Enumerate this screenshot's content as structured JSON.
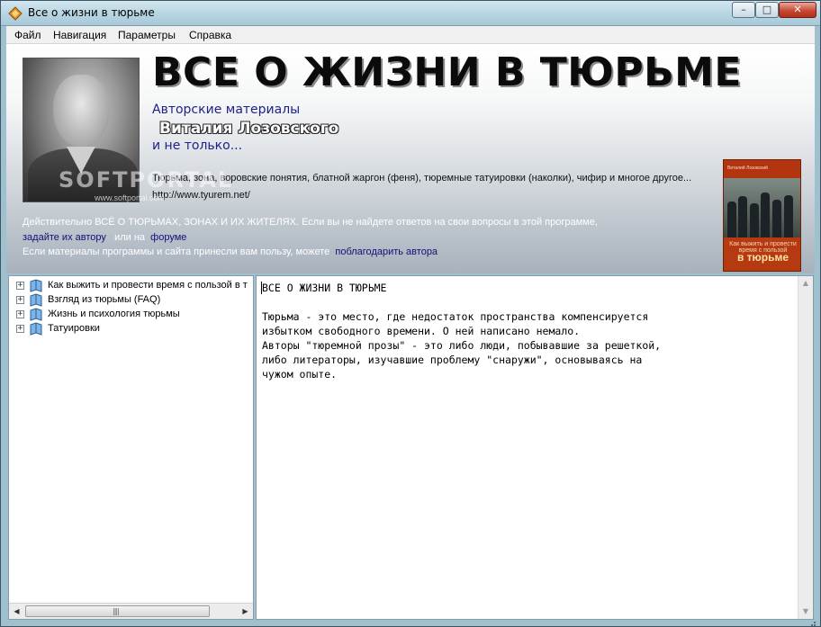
{
  "window": {
    "title": "Все о жизни в тюрьме",
    "minimize_glyph": "–",
    "maximize_glyph": "□",
    "close_glyph": "✕",
    "app_icon": "book-app-icon"
  },
  "menu": {
    "items": [
      "Файл",
      "Навигация",
      "Параметры",
      "Справка"
    ]
  },
  "banner": {
    "title": "ВСЕ О ЖИЗНИ В ТЮРЬМЕ",
    "subtitle1": "Авторские материалы",
    "author": "Виталия Лозовского",
    "subtitle2": "и не только...",
    "topics": "Тюрьма, зона, воровские понятия, блатной жаргон (феня), тюремные татуировки (наколки), чифир и многое другое...",
    "url": "http://www.tyurem.net/",
    "info1": "Действительно ВСЁ О ТЮРЬМАХ, ЗОНАХ И ИХ ЖИТЕЛЯХ. Если вы не найдете ответов на свои вопросы в этой программе,",
    "info2_link1": "задайте их автору",
    "info2_middle": "или на",
    "info2_link2": "форуме",
    "info3_text": "Если материалы программы и сайта принесли вам пользу, можете",
    "info3_link": "поблагодарить автора",
    "watermark": "SOFTPORTAL",
    "watermark_sub": "www.softportal.com",
    "book": {
      "author": "Виталий Лозовский",
      "line1": "Как выжить и провести время с пользой",
      "line2": "в тюрьме"
    }
  },
  "tree": {
    "items": [
      {
        "label": "Как выжить и провести время  с пользой в т",
        "expander": "+"
      },
      {
        "label": "Взгляд из тюрьмы (FAQ)",
        "expander": "+"
      },
      {
        "label": "Жизнь и психология тюрьмы",
        "expander": "+"
      },
      {
        "label": "Татуировки",
        "expander": "+"
      }
    ],
    "scroll_left": "◀",
    "scroll_right": "▶",
    "scroll_grip": "||||"
  },
  "text_panel": {
    "lines": [
      "ВСЕ О ЖИЗНИ В ТЮРЬМЕ",
      "",
      "Тюрьма - это место, где недостаток пространства компенсируется",
      "избытком свободного времени. О ней написано немало.",
      "Авторы \"тюремной прозы\" - это либо люди, побывавшие за решеткой,",
      "либо литераторы, изучавшие проблему \"снаружи\", основываясь на",
      "чужом опыте."
    ],
    "scroll_up": "▲",
    "scroll_down": "▼"
  },
  "colors": {
    "link": "#10107a",
    "subtitle": "#1f1f88",
    "book_cover": "#b53a12"
  }
}
